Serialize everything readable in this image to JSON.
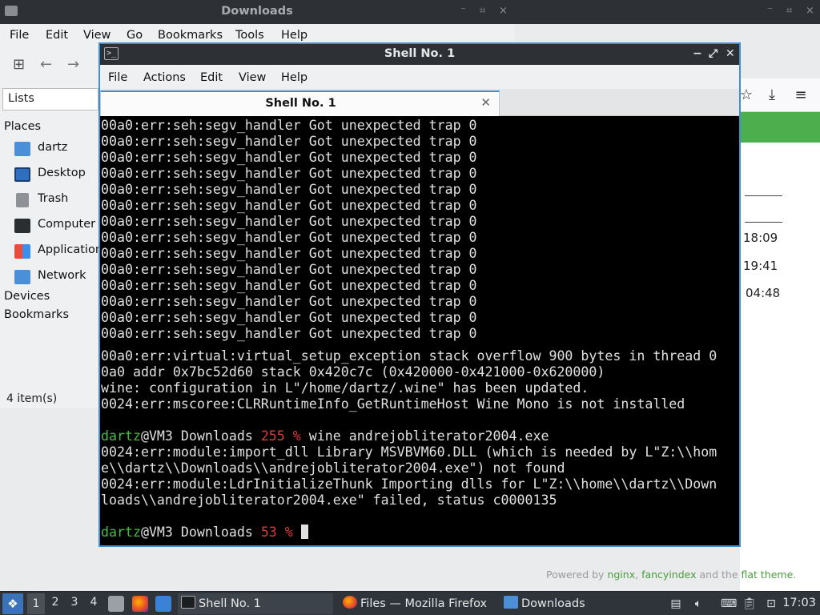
{
  "downloads_window": {
    "title": "Downloads",
    "controls": [
      "⁻",
      "⌗",
      "×"
    ]
  },
  "file_manager": {
    "menu": [
      "File",
      "Edit",
      "View",
      "Go",
      "Bookmarks",
      "Tools",
      "Help"
    ],
    "toolbar_icons": [
      "new-tab-icon",
      "back-arrow-icon",
      "forward-arrow-icon"
    ],
    "side_pane_mode": "Lists",
    "places_heading": "Places",
    "places": [
      {
        "label": "dartz",
        "icon": "home-folder-icon"
      },
      {
        "label": "Desktop",
        "icon": "desktop-icon"
      },
      {
        "label": "Trash",
        "icon": "trash-icon"
      },
      {
        "label": "Computer",
        "icon": "computer-icon"
      },
      {
        "label": "Applications",
        "icon": "applications-icon"
      },
      {
        "label": "Network",
        "icon": "network-icon"
      }
    ],
    "devices_heading": "Devices",
    "bookmarks_heading": "Bookmarks",
    "status": "4 item(s)"
  },
  "browser": {
    "times": [
      "18:09",
      "19:41",
      "04:48"
    ],
    "powered_by": {
      "prefix": "Powered by",
      "link1": "nginx",
      "sep1": ",",
      "link2": "fancyindex",
      "middle": "and the",
      "link3": "flat theme",
      "suffix": "."
    }
  },
  "terminal": {
    "title": "Shell No. 1",
    "menu": [
      "File",
      "Actions",
      "Edit",
      "View",
      "Help"
    ],
    "tab_label": "Shell No. 1",
    "segv_line": "00a0:err:seh:segv_handler Got unexpected trap 0",
    "segv_count": 14,
    "output": [
      "00a0:err:virtual:virtual_setup_exception stack overflow 900 bytes in thread 0",
      "0a0 addr 0x7bc52d60 stack 0x420c7c (0x420000-0x421000-0x620000)",
      "wine: configuration in L\"/home/dartz/.wine\" has been updated.",
      "0024:err:mscoree:CLRRuntimeInfo_GetRuntimeHost Wine Mono is not installed"
    ],
    "prompt1": {
      "user": "dartz",
      "host_dir": "@VM3 Downloads ",
      "code": "255 %",
      "command": " wine andrejobliterator2004.exe"
    },
    "output2": [
      "0024:err:module:import_dll Library MSVBVM60.DLL (which is needed by L\"Z:\\\\hom",
      "e\\\\dartz\\\\Downloads\\\\andrejobliterator2004.exe\") not found",
      "0024:err:module:LdrInitializeThunk Importing dlls for L\"Z:\\\\home\\\\dartz\\\\Down",
      "loads\\\\andrejobliterator2004.exe\" failed, status c0000135"
    ],
    "prompt2": {
      "user": "dartz",
      "host_dir": "@VM3 Downloads ",
      "code": "53 %",
      "command": " "
    }
  },
  "taskbar": {
    "workspaces": [
      "1",
      "2",
      "3",
      "4"
    ],
    "tasks": [
      {
        "label": "Shell No. 1",
        "icon": "terminal-icon"
      },
      {
        "label": "Files — Mozilla Firefox",
        "icon": "firefox-icon"
      },
      {
        "label": "Downloads",
        "icon": "folder-icon"
      }
    ],
    "clock": "17:03"
  },
  "colors": {
    "accent": "#3f8fd2",
    "prompt_user": "#3ec13e",
    "prompt_code": "#e03a3a",
    "terminal_bg": "#000000",
    "panel_bg": "#2f343a"
  }
}
